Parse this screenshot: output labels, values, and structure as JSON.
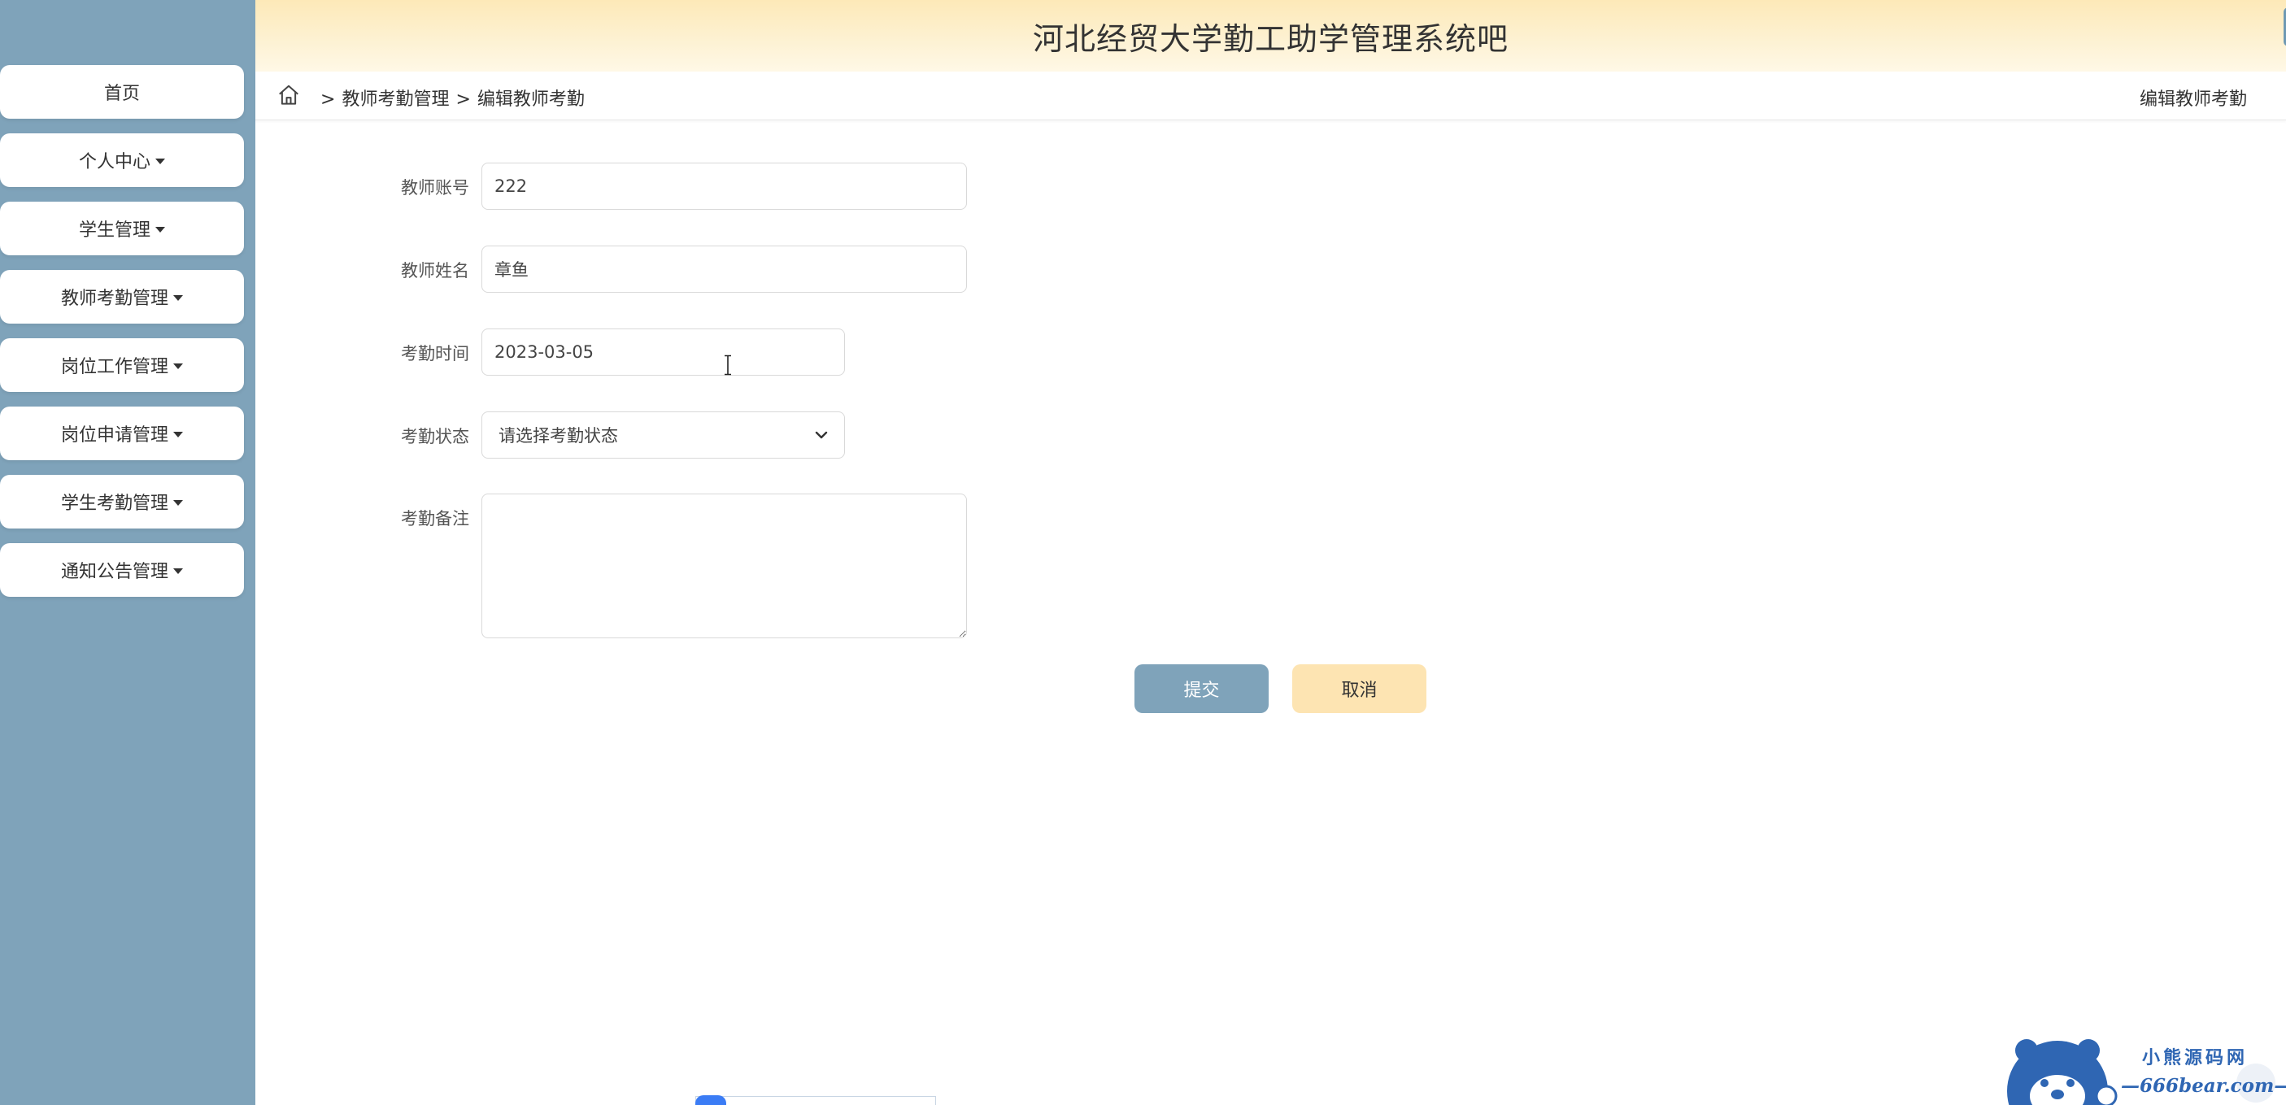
{
  "header": {
    "title": "河北经贸大学勤工助学管理系统吧"
  },
  "sidebar": {
    "items": [
      {
        "label": "首页",
        "dropdown": false
      },
      {
        "label": "个人中心",
        "dropdown": true
      },
      {
        "label": "学生管理",
        "dropdown": true
      },
      {
        "label": "教师考勤管理",
        "dropdown": true
      },
      {
        "label": "岗位工作管理",
        "dropdown": true
      },
      {
        "label": "岗位申请管理",
        "dropdown": true
      },
      {
        "label": "学生考勤管理",
        "dropdown": true
      },
      {
        "label": "通知公告管理",
        "dropdown": true
      }
    ]
  },
  "breadcrumb": {
    "separator": ">",
    "level1": "教师考勤管理",
    "level2": "编辑教师考勤",
    "right_title": "编辑教师考勤"
  },
  "form": {
    "account": {
      "label": "教师账号",
      "value": "222"
    },
    "name": {
      "label": "教师姓名",
      "value": "章鱼"
    },
    "time": {
      "label": "考勤时间",
      "value": "2023-03-05"
    },
    "status": {
      "label": "考勤状态",
      "value": "请选择考勤状态"
    },
    "remark": {
      "label": "考勤备注",
      "value": ""
    },
    "submit_label": "提交",
    "cancel_label": "取消"
  },
  "watermark": {
    "cn": "小熊源码网",
    "en": "—666bear.com—"
  },
  "colors": {
    "sidebar": "#7fa3ba",
    "submit": "#7fa3ba",
    "cancel": "#fde4b2",
    "header_gradient": "#fde9b8"
  }
}
